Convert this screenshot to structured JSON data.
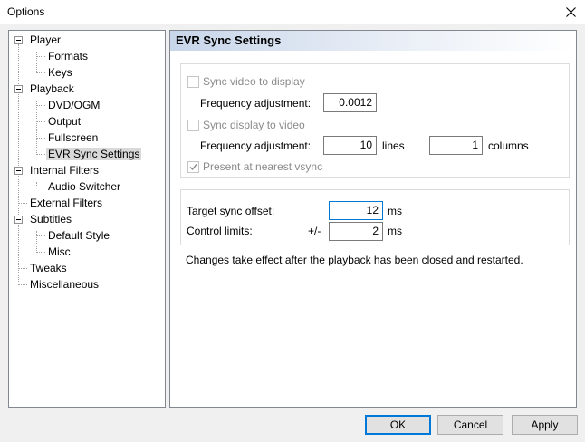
{
  "window": {
    "title": "Options"
  },
  "tree": {
    "items": [
      {
        "label": "Player",
        "level": 0,
        "expandable": true
      },
      {
        "label": "Formats",
        "level": 1
      },
      {
        "label": "Keys",
        "level": 1
      },
      {
        "label": "Playback",
        "level": 0,
        "expandable": true
      },
      {
        "label": "DVD/OGM",
        "level": 1
      },
      {
        "label": "Output",
        "level": 1
      },
      {
        "label": "Fullscreen",
        "level": 1
      },
      {
        "label": "EVR Sync Settings",
        "level": 1,
        "selected": true
      },
      {
        "label": "Internal Filters",
        "level": 0,
        "expandable": true
      },
      {
        "label": "Audio Switcher",
        "level": 1
      },
      {
        "label": "External Filters",
        "level": 0
      },
      {
        "label": "Subtitles",
        "level": 0,
        "expandable": true
      },
      {
        "label": "Default Style",
        "level": 1
      },
      {
        "label": "Misc",
        "level": 1
      },
      {
        "label": "Tweaks",
        "level": 0
      },
      {
        "label": "Miscellaneous",
        "level": 0
      }
    ]
  },
  "panel": {
    "title": "EVR Sync Settings",
    "sync_video": {
      "label": "Sync video to display",
      "checked": false
    },
    "freq_adj_label_1": "Frequency adjustment:",
    "freq_adj_value_1": "0.0012",
    "sync_display": {
      "label": "Sync display to video",
      "checked": false
    },
    "freq_adj_label_2": "Frequency adjustment:",
    "lines_value": "10",
    "lines_unit": "lines",
    "columns_value": "1",
    "columns_unit": "columns",
    "present_vsync": {
      "label": "Present at nearest vsync",
      "checked": true
    },
    "target_offset_label": "Target sync offset:",
    "target_offset_value": "12",
    "target_offset_unit": "ms",
    "control_limits_label": "Control limits:",
    "control_limits_prefix": "+/-",
    "control_limits_value": "2",
    "control_limits_unit": "ms",
    "note": "Changes take effect after the playback has been closed and restarted."
  },
  "buttons": {
    "ok": "OK",
    "cancel": "Cancel",
    "apply": "Apply"
  }
}
